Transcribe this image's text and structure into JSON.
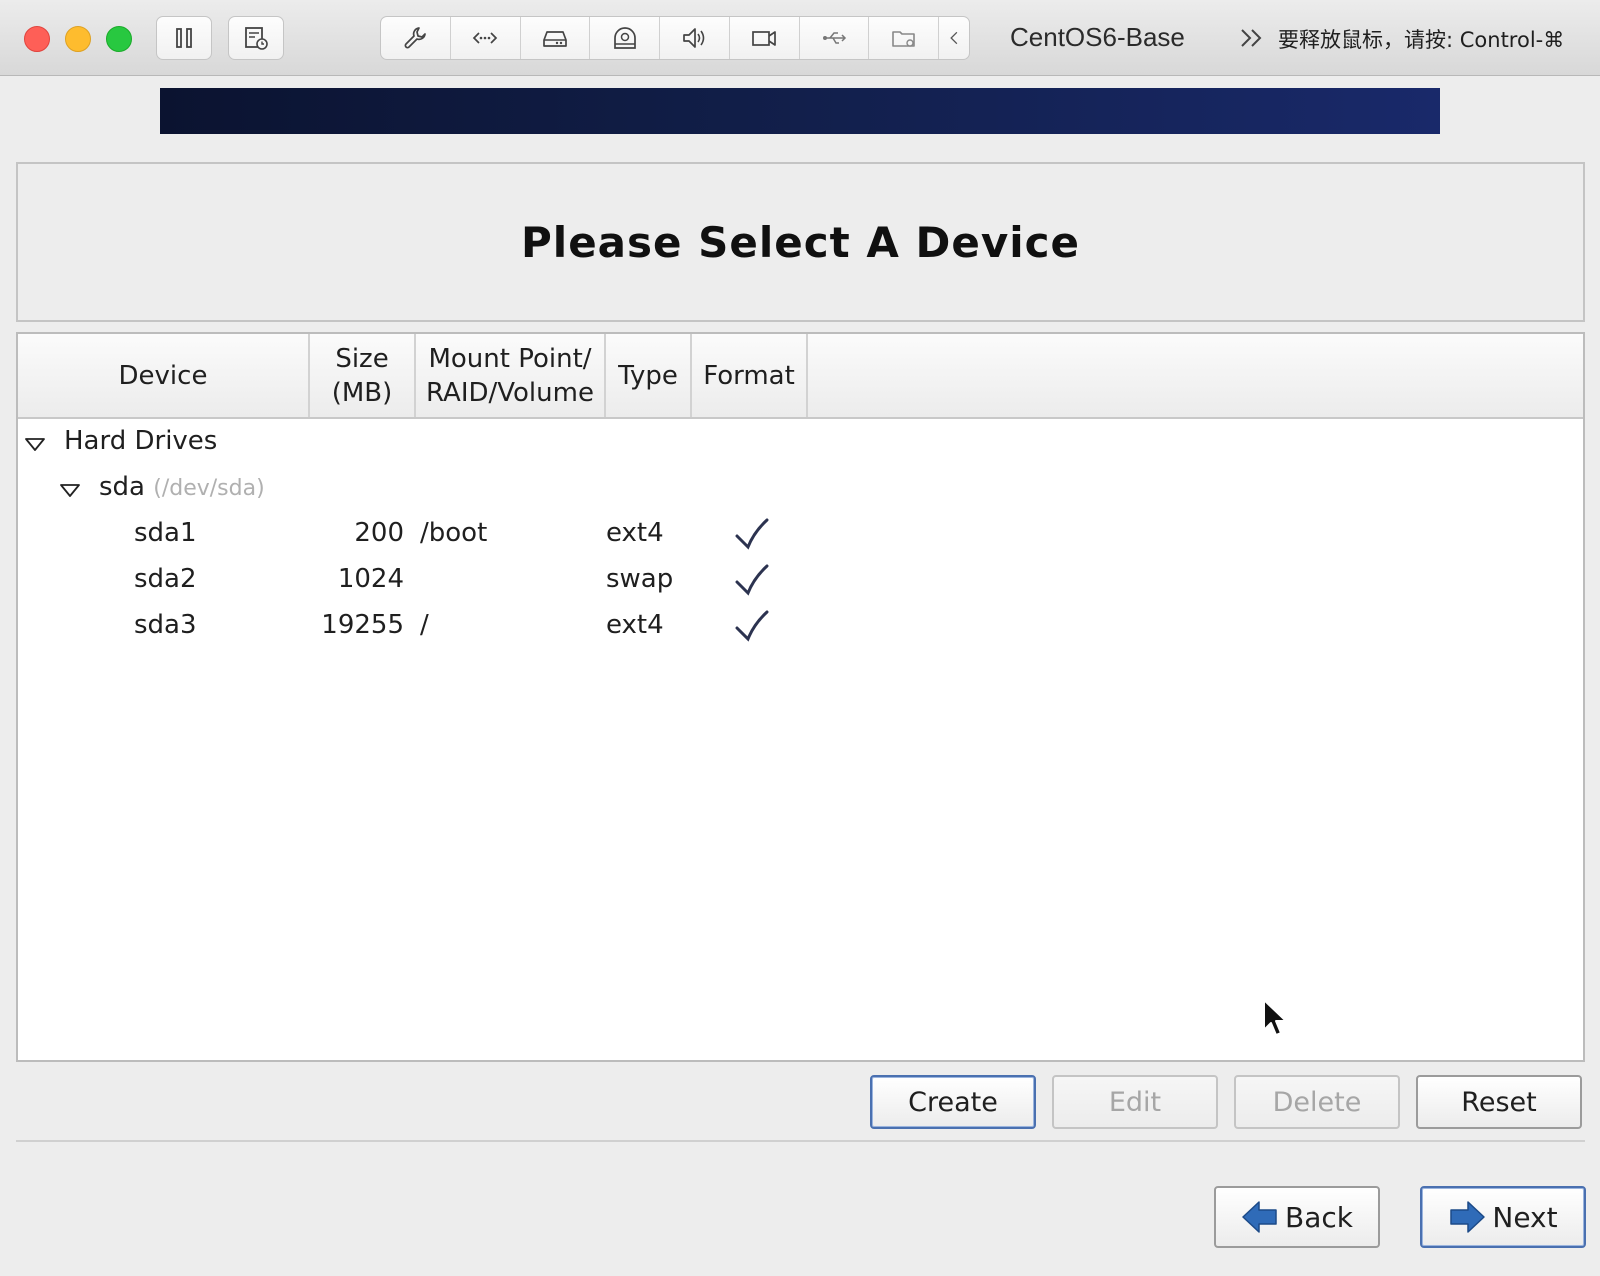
{
  "window": {
    "vm_title": "CentOS6-Base",
    "release_hint": "要释放鼠标，请按: Control-⌘",
    "toolbar_icons": [
      "pause-icon",
      "snapshot-icon",
      "wrench-icon",
      "network-icon",
      "disk-icon",
      "cd-icon",
      "sound-icon",
      "camera-icon",
      "usb-icon",
      "shared-folder-icon",
      "collapse-icon"
    ]
  },
  "page": {
    "heading": "Please Select A Device"
  },
  "table": {
    "columns": {
      "device": "Device",
      "size_line1": "Size",
      "size_line2": "(MB)",
      "mount_line1": "Mount Point/",
      "mount_line2": "RAID/Volume",
      "type": "Type",
      "format": "Format"
    },
    "group": "Hard Drives",
    "disk": {
      "name": "sda",
      "path": "(/dev/sda)"
    },
    "partitions": [
      {
        "device": "sda1",
        "size": "200",
        "mount": "/boot",
        "type": "ext4",
        "format": true
      },
      {
        "device": "sda2",
        "size": "1024",
        "mount": "",
        "type": "swap",
        "format": true
      },
      {
        "device": "sda3",
        "size": "19255",
        "mount": "/",
        "type": "ext4",
        "format": true
      }
    ]
  },
  "actions": {
    "create": "Create",
    "edit": "Edit",
    "delete": "Delete",
    "reset": "Reset"
  },
  "nav": {
    "back": "Back",
    "next": "Next"
  },
  "colors": {
    "banner": "#111e48",
    "check": "#2c3350",
    "nav_arrow": "#2f6bb8"
  }
}
